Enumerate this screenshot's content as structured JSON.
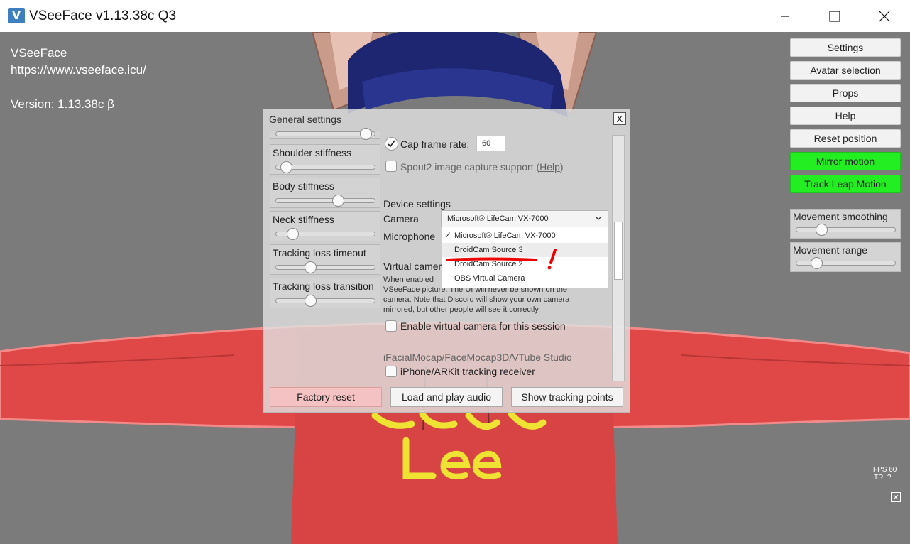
{
  "window": {
    "title": "VSeeFace v1.13.38c Q3",
    "icon": "vseeface-app-icon",
    "icon_glyph": "V"
  },
  "info": {
    "app_name": "VSeeFace",
    "url": "https://www.vseeface.icu/",
    "version": "Version: 1.13.38c β"
  },
  "right_panel": {
    "buttons": [
      "Settings",
      "Avatar selection",
      "Props",
      "Help",
      "Reset position"
    ],
    "toggles": [
      "Mirror motion",
      "Track Leap Motion"
    ],
    "sliders": [
      {
        "label": "Movement smoothing",
        "value": 0.22
      },
      {
        "label": "Movement range",
        "value": 0.16
      }
    ],
    "fps": "FPS 60",
    "tr": "TR  ?"
  },
  "dialog": {
    "title": "General settings",
    "close": "X",
    "sliders": [
      {
        "label": "Shoulder stiffness",
        "value": 0.05
      },
      {
        "label": "Body stiffness",
        "value": 0.65
      },
      {
        "label": "Neck stiffness",
        "value": 0.12
      },
      {
        "label": "Tracking loss timeout",
        "value": 0.33
      },
      {
        "label": "Tracking loss transition",
        "value": 0.33
      }
    ],
    "cap_frame_rate": {
      "label": "Cap frame rate:",
      "value": "60",
      "checked": true
    },
    "spout": {
      "label": "Spout2 image capture support (",
      "help": "Help",
      "suffix": ")"
    },
    "device_settings": "Device settings",
    "camera_label": "Camera",
    "camera_value": "Microsoft® LifeCam VX-7000",
    "microphone_label": "Microphone",
    "camera_options": [
      "Microsoft® LifeCam VX-7000",
      "DroidCam Source 3",
      "DroidCam Source 2",
      "OBS Virtual Camera"
    ],
    "virtual_camera_label": "Virtual camer",
    "virtual_camera_desc": [
      "When enabled",
      "VSeeFace picture. The UI will never be shown on the",
      "camera. Note that Discord will show your own camera",
      "mirrored, but other people will see it correctly."
    ],
    "enable_virtual_camera": "Enable virtual camera for this session",
    "ifacial_header": "iFacialMocap/FaceMocap3D/VTube Studio",
    "iphone_receiver": "iPhone/ARKit tracking receiver",
    "buttons": {
      "factory_reset": "Factory reset",
      "load_audio": "Load and play audio",
      "show_points": "Show tracking points"
    }
  },
  "colors": {
    "toggle_on": "#22ee22",
    "factory_reset": "#f4c2c2",
    "hoodie": "#e04848",
    "hair": "#1e2672",
    "annotation": "#ee0000"
  }
}
